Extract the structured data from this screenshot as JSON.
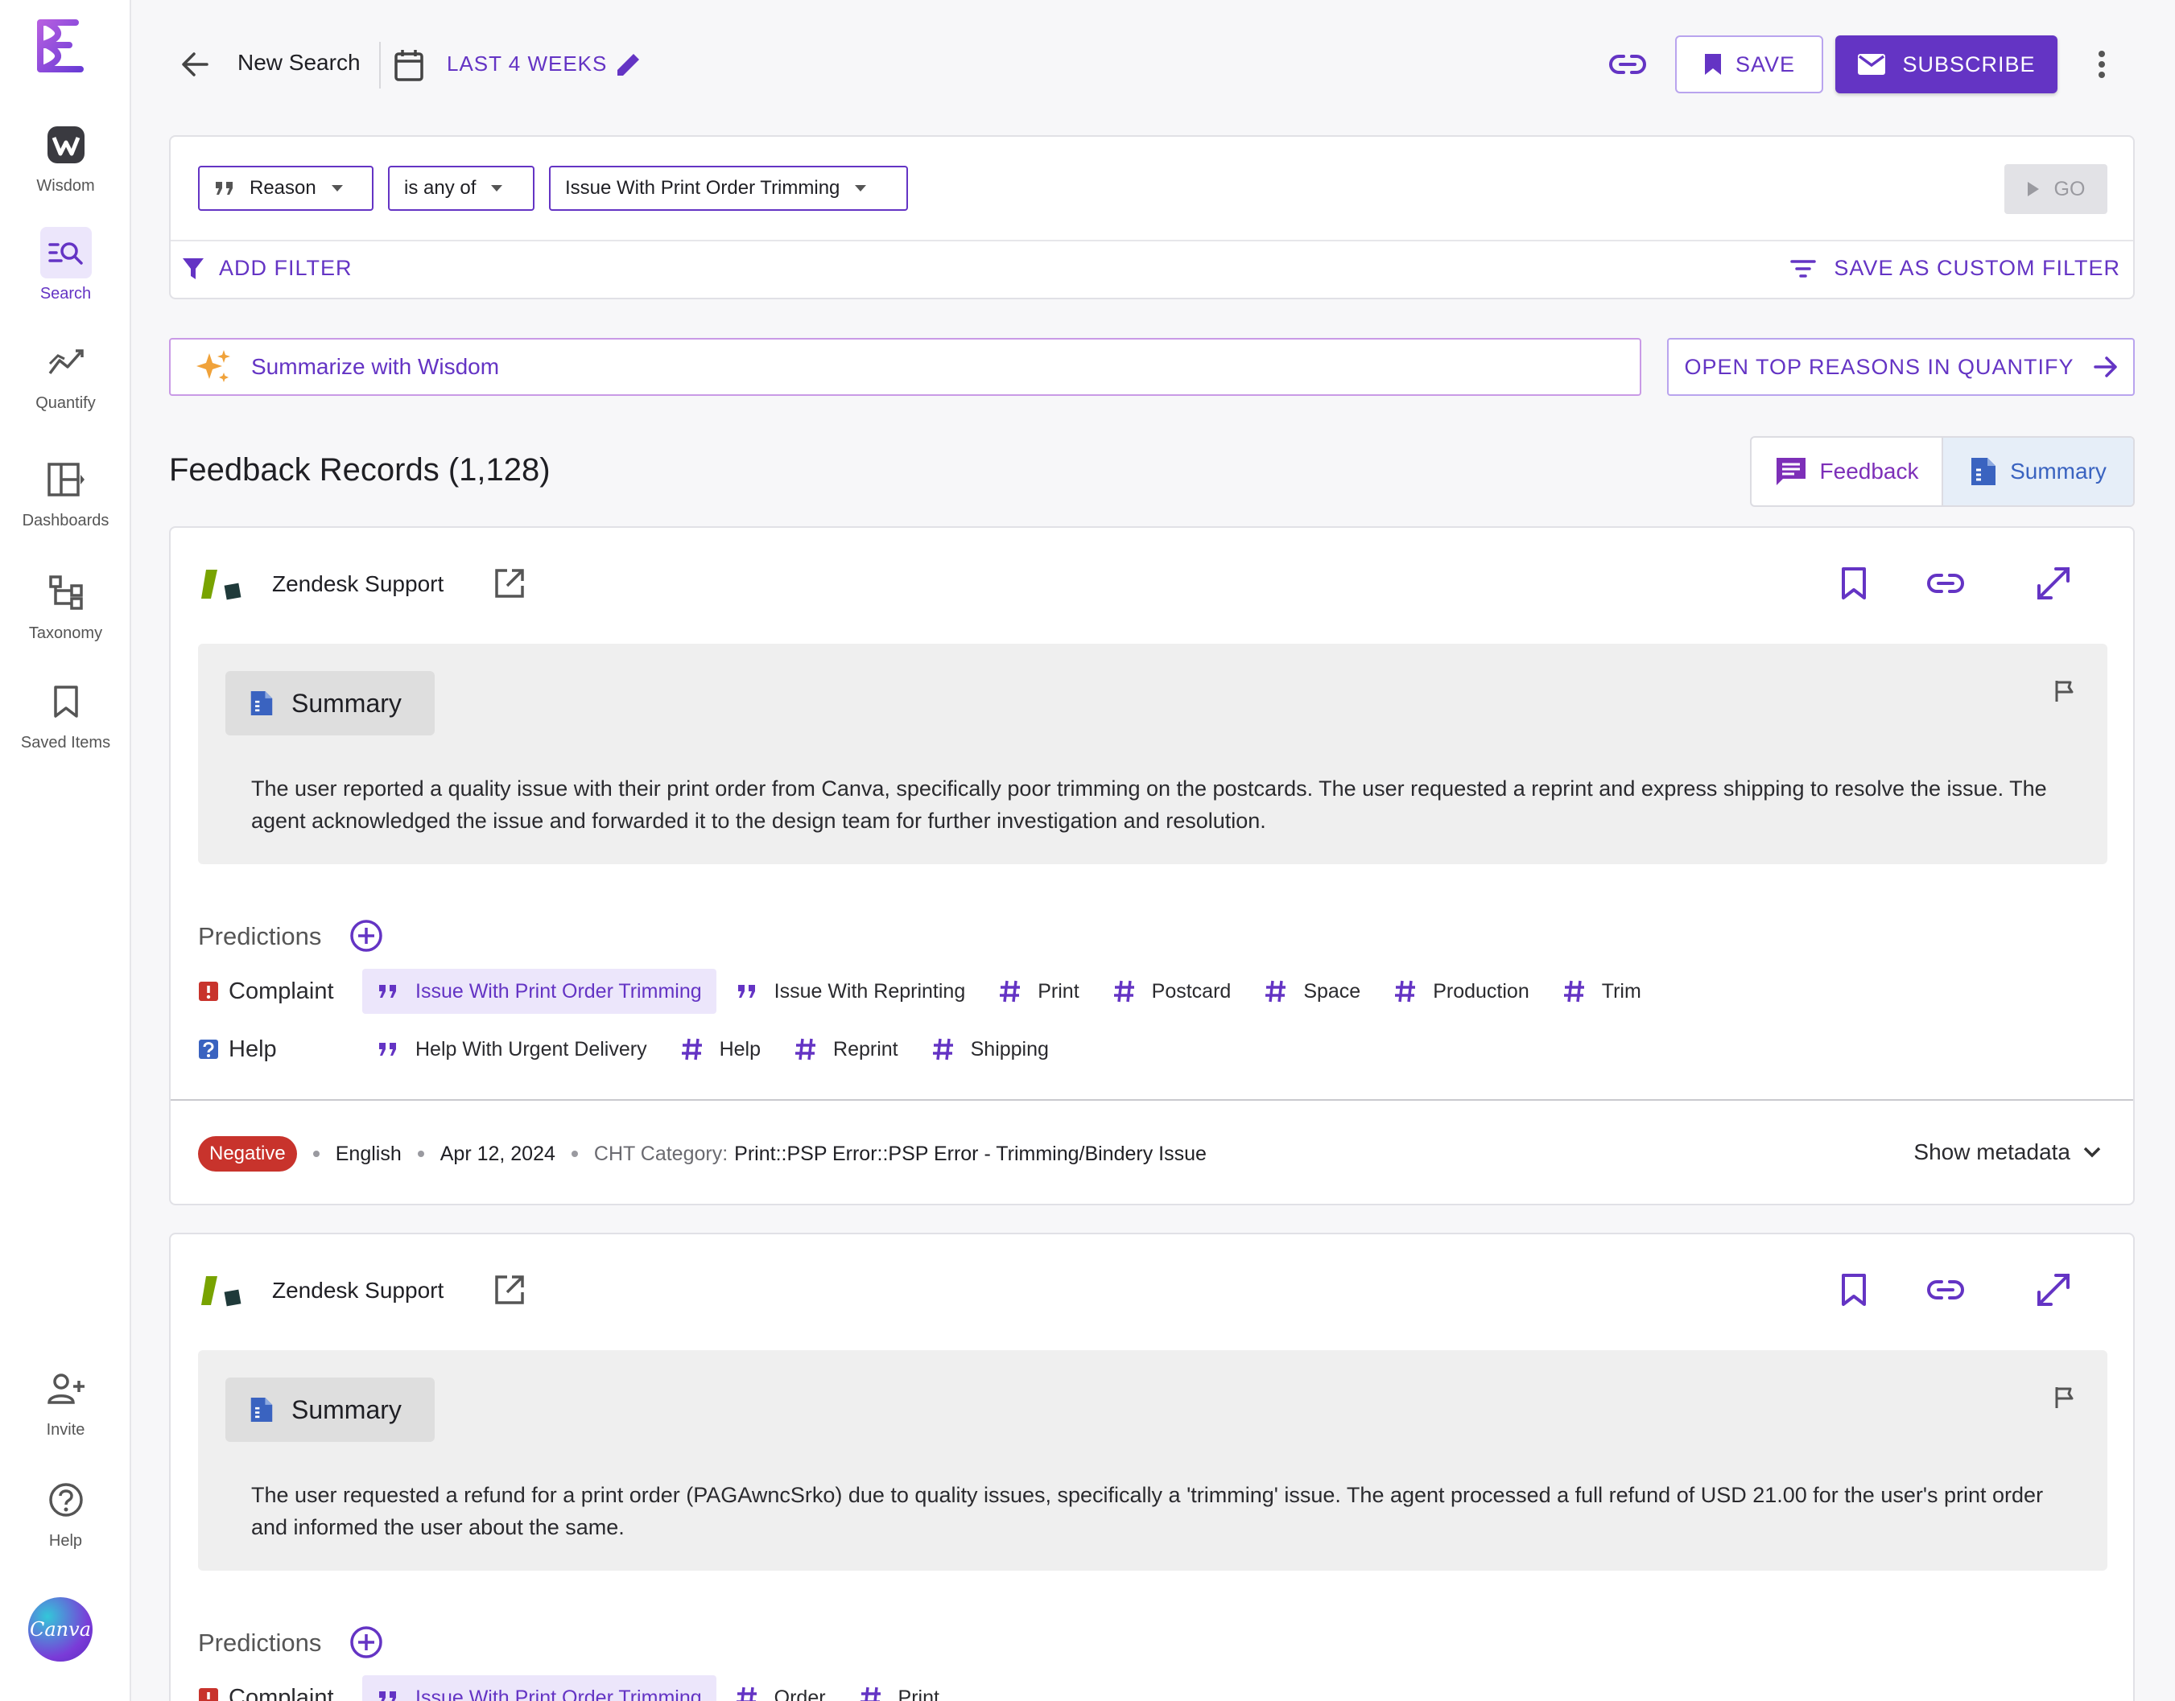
{
  "sidebar": {
    "items": [
      {
        "label": "Wisdom"
      },
      {
        "label": "Search"
      },
      {
        "label": "Quantify"
      },
      {
        "label": "Dashboards"
      },
      {
        "label": "Taxonomy"
      },
      {
        "label": "Saved Items"
      }
    ],
    "bottom": [
      {
        "label": "Invite"
      },
      {
        "label": "Help"
      }
    ],
    "workspace_logo": "Canva"
  },
  "topbar": {
    "title": "New Search",
    "date_range": "LAST 4 WEEKS",
    "save_label": "SAVE",
    "subscribe_label": "SUBSCRIBE"
  },
  "filter": {
    "field": "Reason",
    "operator": "is any of",
    "value": "Issue With Print Order Trimming",
    "go_label": "GO",
    "add_filter_label": "ADD FILTER",
    "save_custom_label": "SAVE AS CUSTOM FILTER"
  },
  "actions": {
    "summarize_label": "Summarize with Wisdom",
    "open_top_label": "OPEN TOP REASONS IN QUANTIFY"
  },
  "records": {
    "title": "Feedback Records (1,128)",
    "toggle_feedback": "Feedback",
    "toggle_summary": "Summary"
  },
  "cards": [
    {
      "source": "Zendesk Support",
      "summary_label": "Summary",
      "summary_text": "The user reported a quality issue with their print order from Canva, specifically poor trimming on the postcards. The user requested a reprint and express shipping to resolve the issue. The agent acknowledged the issue and forwarded it to the design team for further investigation and resolution.",
      "predictions_label": "Predictions",
      "rows": [
        {
          "category": "Complaint",
          "reasons": [
            "Issue With Print Order Trimming",
            "Issue With Reprinting"
          ],
          "tags": [
            "Print",
            "Postcard",
            "Space",
            "Production",
            "Trim"
          ]
        },
        {
          "category": "Help",
          "reasons": [
            "Help With Urgent Delivery"
          ],
          "tags": [
            "Help",
            "Reprint",
            "Shipping"
          ]
        }
      ],
      "sentiment": "Negative",
      "language": "English",
      "date": "Apr 12, 2024",
      "category_label": "CHT Category:",
      "category_value": "Print::PSP Error::PSP Error - Trimming/Bindery Issue",
      "show_metadata": "Show metadata"
    },
    {
      "source": "Zendesk Support",
      "summary_label": "Summary",
      "summary_text": "The user requested a refund for a print order (PAGAwncSrko) due to quality issues, specifically a 'trimming' issue. The agent processed a full refund of USD 21.00 for the user's print order and informed the user about the same.",
      "predictions_label": "Predictions",
      "rows": [
        {
          "category": "Complaint",
          "reasons": [
            "Issue With Print Order Trimming"
          ],
          "tags": [
            "Order",
            "Print"
          ]
        }
      ]
    }
  ],
  "colors": {
    "primary": "#6434c4",
    "negative": "#c8332c",
    "summary_blue": "#3a63c0"
  }
}
